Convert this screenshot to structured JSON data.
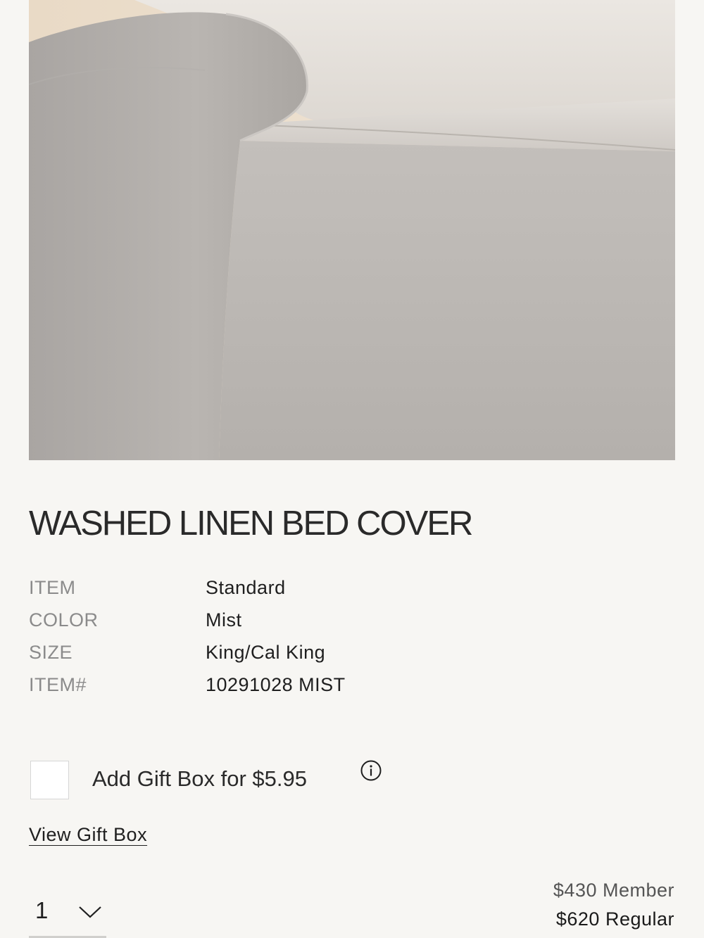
{
  "product": {
    "title": "WASHED LINEN BED COVER",
    "image_alt": "Washed linen bed cover in mist"
  },
  "specs": [
    {
      "label": "ITEM",
      "value": "Standard"
    },
    {
      "label": "COLOR",
      "value": "Mist"
    },
    {
      "label": "SIZE",
      "value": "King/Cal King"
    },
    {
      "label": "ITEM#",
      "value": "10291028 MIST"
    }
  ],
  "gift": {
    "checkbox_checked": false,
    "label": "Add Gift Box for $5.95",
    "info_icon": "info-circle-icon",
    "view_link": "View Gift Box"
  },
  "quantity": {
    "value": "1",
    "chevron_icon": "chevron-down-icon"
  },
  "pricing": {
    "member": "$430 Member",
    "regular": "$620 Regular"
  }
}
